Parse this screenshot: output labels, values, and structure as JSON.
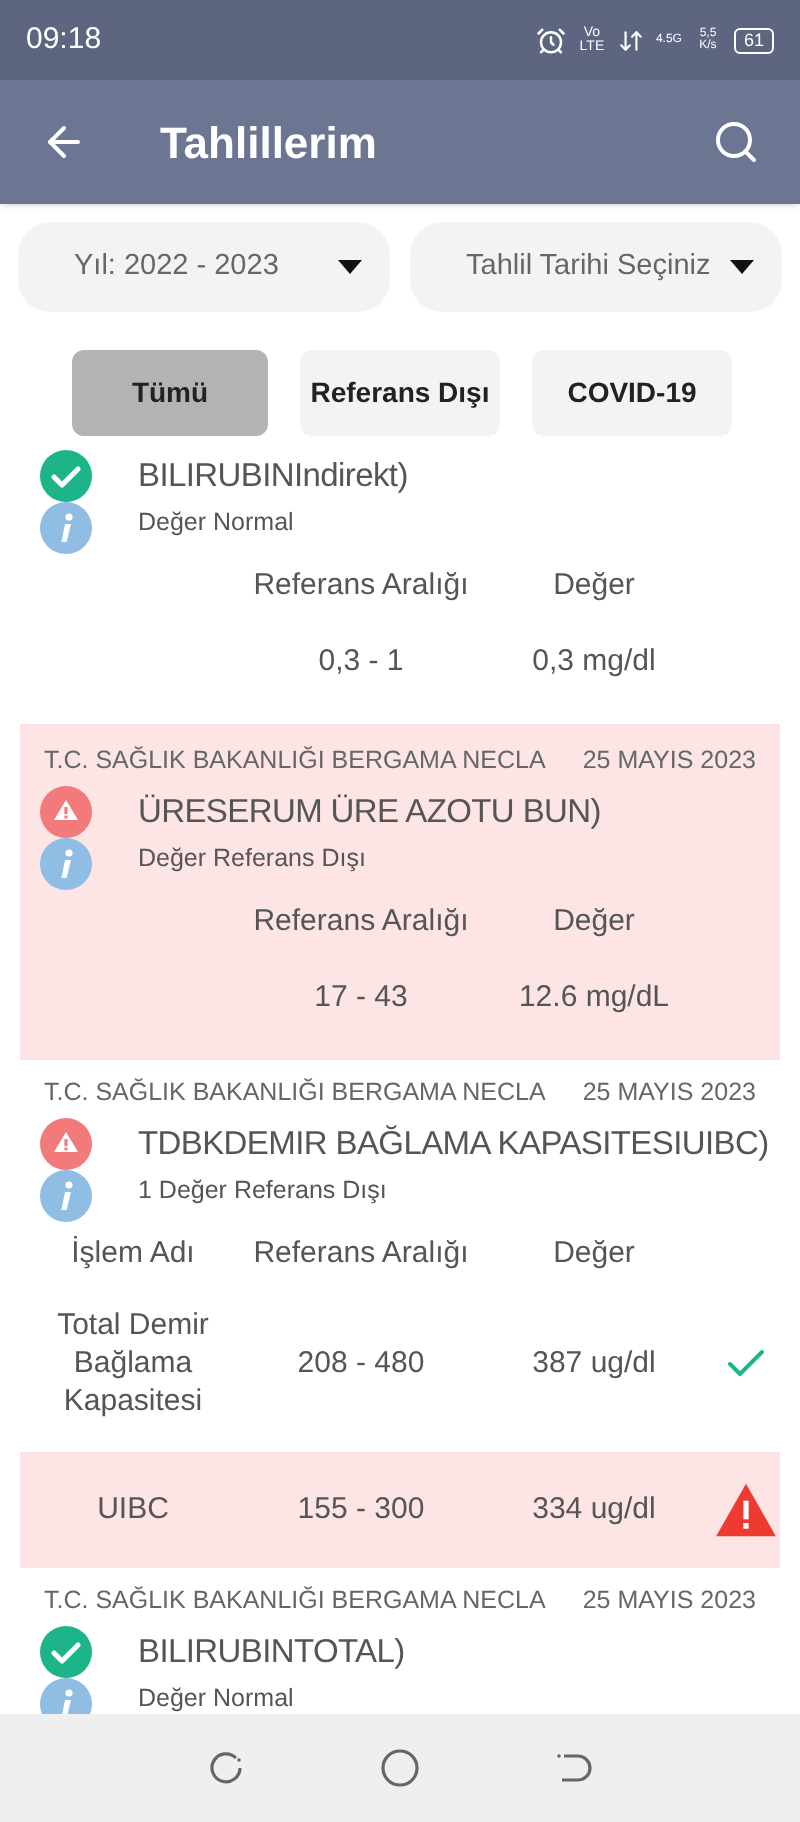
{
  "status_bar": {
    "time": "09:18",
    "volte": "Vo LTE",
    "network": "4.5G",
    "speed": "5,5 K/s",
    "battery": "61"
  },
  "app_bar": {
    "title": "Tahlillerim"
  },
  "filters": [
    {
      "label": "Yıl: 2022 - 2023"
    },
    {
      "label": "Tahlil Tarihi Seçiniz"
    }
  ],
  "chips": [
    {
      "label": "Tümü",
      "selected": true
    },
    {
      "label": "Referans Dışı",
      "selected": false
    },
    {
      "label": "COVID-19",
      "selected": false
    }
  ],
  "results": [
    {
      "out_of_range": false,
      "highlighted": false,
      "name": "BILIRUBINIndirekt)",
      "summary": "Değer Normal",
      "columns": [
        "Referans Aralığı",
        "Değer"
      ],
      "rows": [
        {
          "range": "0,3 - 1",
          "value": "0,3 mg/dl"
        }
      ]
    },
    {
      "out_of_range": true,
      "highlighted": true,
      "hospital": "T.C. SAĞLIK BAKANLIĞI BERGAMA NECLA",
      "date": "25 MAYIS 2023",
      "name": "ÜRESERUM ÜRE AZOTU BUN)",
      "summary": "Değer Referans Dışı",
      "columns": [
        "Referans Aralığı",
        "Değer"
      ],
      "rows": [
        {
          "range": "17 - 43",
          "value": "12.6 mg/dL"
        }
      ]
    },
    {
      "out_of_range": true,
      "highlighted": false,
      "hospital": "T.C. SAĞLIK BAKANLIĞI BERGAMA NECLA",
      "date": "25 MAYIS 2023",
      "name": "TDBKDEMIR BAĞLAMA KAPASITESIUIBC)",
      "summary": "1 Değer Referans Dışı",
      "columns": [
        "İşlem Adı",
        "Referans Aralığı",
        "Değer"
      ],
      "rows": [
        {
          "name": "Total Demir Bağlama Kapasitesi",
          "range": "208 - 480",
          "value": "387 ug/dl",
          "out_of_range": false
        },
        {
          "name": "UIBC",
          "range": "155 - 300",
          "value": "334 ug/dl",
          "out_of_range": true
        }
      ]
    },
    {
      "out_of_range": false,
      "highlighted": false,
      "hospital": "T.C. SAĞLIK BAKANLIĞI BERGAMA NECLA",
      "date": "25 MAYIS 2023",
      "name": "BILIRUBINTOTAL)",
      "summary": "Değer Normal"
    }
  ]
}
